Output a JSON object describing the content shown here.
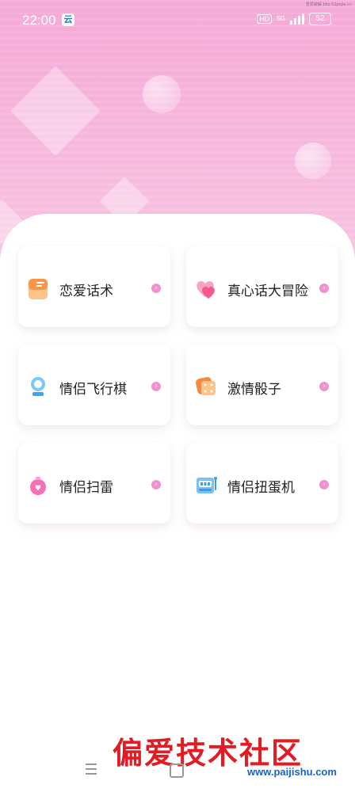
{
  "status_bar": {
    "time": "22:00",
    "app_badge_glyph": "云",
    "hd_label": "HD",
    "network_label": "5G",
    "battery": "52"
  },
  "watermark_small": "吾爱破解 bbs.52pojie.cn",
  "cards": [
    {
      "label": "恋爱话术",
      "icon": "notebook-icon",
      "color": "#f9964a"
    },
    {
      "label": "真心话大冒险",
      "icon": "hearts-icon",
      "color": "#f45b8b"
    },
    {
      "label": "情侣飞行棋",
      "icon": "pawn-icon",
      "color": "#3aa8ef"
    },
    {
      "label": "激情骰子",
      "icon": "dice-icon",
      "color": "#f58a3a"
    },
    {
      "label": "情侣扫雷",
      "icon": "bomb-icon",
      "color": "#f46fb7"
    },
    {
      "label": "情侣扭蛋机",
      "icon": "gacha-machine-icon",
      "color": "#3a9de8"
    }
  ],
  "watermark": {
    "chinese": "偏爱技术社区",
    "url": "www.paijishu.com"
  },
  "colors": {
    "hero_top": "#f4a9d6",
    "arrow": "#f48fd0"
  }
}
